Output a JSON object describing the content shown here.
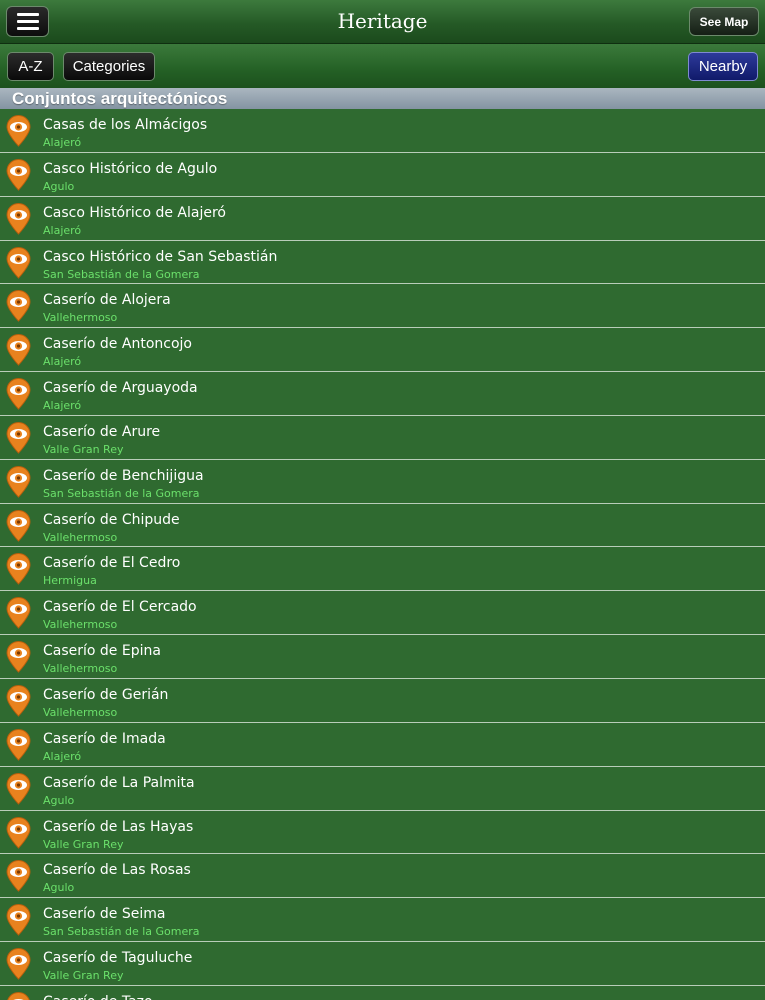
{
  "navbar": {
    "title": "Heritage",
    "see_map_label": "See Map"
  },
  "toolbar": {
    "az_label": "A-Z",
    "categories_label": "Categories",
    "nearby_label": "Nearby"
  },
  "section": {
    "title": "Conjuntos arquitectónicos"
  },
  "items": [
    {
      "name": "Casas de los Almácigos",
      "place": "Alajeró"
    },
    {
      "name": "Casco Histórico de Agulo",
      "place": "Agulo"
    },
    {
      "name": "Casco Histórico de Alajeró",
      "place": "Alajeró"
    },
    {
      "name": "Casco Histórico de San Sebastián",
      "place": "San Sebastián de la Gomera"
    },
    {
      "name": "Caserío de Alojera",
      "place": "Vallehermoso"
    },
    {
      "name": "Caserío de Antoncojo",
      "place": "Alajeró"
    },
    {
      "name": "Caserío de Arguayoda",
      "place": "Alajeró"
    },
    {
      "name": "Caserío de Arure",
      "place": "Valle Gran Rey"
    },
    {
      "name": "Caserío de Benchijigua",
      "place": "San Sebastián de la Gomera"
    },
    {
      "name": "Caserío de Chipude",
      "place": "Vallehermoso"
    },
    {
      "name": "Caserío de El Cedro",
      "place": "Hermigua"
    },
    {
      "name": "Caserío de El Cercado",
      "place": "Vallehermoso"
    },
    {
      "name": "Caserío de Epina",
      "place": "Vallehermoso"
    },
    {
      "name": "Caserío de Gerián",
      "place": "Vallehermoso"
    },
    {
      "name": "Caserío de Imada",
      "place": "Alajeró"
    },
    {
      "name": "Caserío de La Palmita",
      "place": "Agulo"
    },
    {
      "name": "Caserío de Las Hayas",
      "place": "Valle Gran Rey"
    },
    {
      "name": "Caserío de Las Rosas",
      "place": "Agulo"
    },
    {
      "name": "Caserío de Seima",
      "place": "San Sebastián de la Gomera"
    },
    {
      "name": "Caserío de Taguluche",
      "place": "Valle Gran Rey"
    },
    {
      "name": "Caserío de Tazo...",
      "place": ""
    }
  ],
  "colors": {
    "background": "#2f6a30",
    "pin": "#e8821e",
    "subtitle": "#6be06b"
  },
  "icons": {
    "menu": "hamburger-menu-icon",
    "pin": "eye-map-pin-icon"
  }
}
